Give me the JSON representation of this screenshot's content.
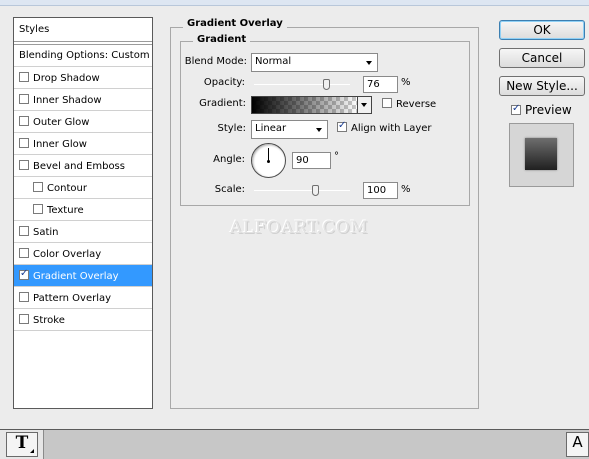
{
  "styles_panel": {
    "header": "Styles",
    "blending_options": "Blending Options: Custom",
    "items": [
      {
        "label": "Drop Shadow",
        "checked": false
      },
      {
        "label": "Inner Shadow",
        "checked": false
      },
      {
        "label": "Outer Glow",
        "checked": false
      },
      {
        "label": "Inner Glow",
        "checked": false
      },
      {
        "label": "Bevel and Emboss",
        "checked": false
      },
      {
        "label": "Contour",
        "checked": false
      },
      {
        "label": "Texture",
        "checked": false
      },
      {
        "label": "Satin",
        "checked": false
      },
      {
        "label": "Color Overlay",
        "checked": false
      },
      {
        "label": "Gradient Overlay",
        "checked": true
      },
      {
        "label": "Pattern Overlay",
        "checked": false
      },
      {
        "label": "Stroke",
        "checked": false
      }
    ]
  },
  "gradient_overlay": {
    "section_title": "Gradient Overlay",
    "group_title": "Gradient",
    "blend_mode_label": "Blend Mode:",
    "blend_mode_value": "Normal",
    "opacity_label": "Opacity:",
    "opacity_value": "76",
    "opacity_unit": "%",
    "opacity_level": 0.76,
    "gradient_label": "Gradient:",
    "reverse_label": "Reverse",
    "reverse_checked": false,
    "style_label": "Style:",
    "style_value": "Linear",
    "align_label": "Align with Layer",
    "align_checked": true,
    "angle_label": "Angle:",
    "angle_value": "90",
    "angle_unit": "°",
    "scale_label": "Scale:",
    "scale_value": "100",
    "scale_unit": "%"
  },
  "buttons": {
    "ok": "OK",
    "cancel": "Cancel",
    "new_style": "New Style...",
    "preview_label": "Preview",
    "preview_checked": true
  },
  "watermark": "ALFOART.COM",
  "toolbar": {
    "text_tool_glyph": "T",
    "right_tool_glyph": "A"
  },
  "colors": {
    "selection": "#3399ff",
    "default_button_border": "#3c7fb1"
  }
}
